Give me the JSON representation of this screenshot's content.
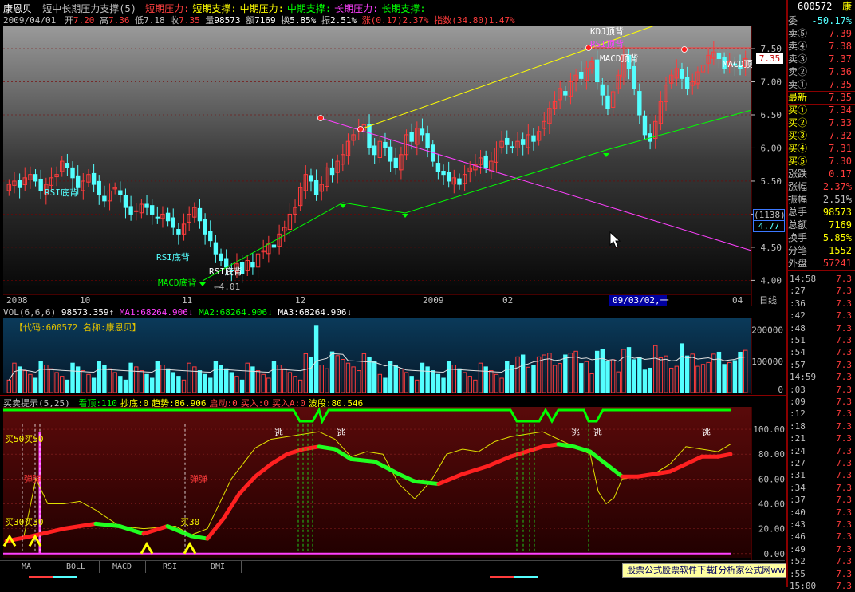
{
  "header": {
    "stock_name": "康恩贝",
    "indicator_title": "短中长期压力支撑(5)",
    "lines": [
      {
        "label": "短期压力:",
        "color": "#ff4040"
      },
      {
        "label": "短期支撑:",
        "color": "#ffff00"
      },
      {
        "label": "中期压力:",
        "color": "#ffff00"
      },
      {
        "label": "中期支撑:",
        "color": "#00ff00"
      },
      {
        "label": "长期压力:",
        "color": "#ff40ff"
      },
      {
        "label": "长期支撑:",
        "color": "#00ff00"
      }
    ],
    "date": "2009/04/01",
    "open_label": "开",
    "open": "7.20",
    "high_label": "高",
    "high": "7.36",
    "low_label": "低",
    "low": "7.18",
    "close_label": "收",
    "close": "7.35",
    "vol_label": "量",
    "vol": "98573",
    "amount_label": "额",
    "amount": "7169",
    "turnover_label": "换",
    "turnover": "5.85%",
    "amplitude_label": "振",
    "amplitude": "2.51%",
    "change_label": "涨",
    "change": "(0.17)",
    "change_pct": "2.37%",
    "index_label": "指数",
    "index": "(34.80)",
    "index_pct": "1.47%"
  },
  "main_chart": {
    "annotations": {
      "kdj_top": "KDJ顶背",
      "rsi_top": "RSI顶背",
      "macd_top": "MACD顶背",
      "macd_top2": "MACD顶",
      "rsi_bottom1": "RSI底背",
      "rsi_bottom2": "RSI底背",
      "rsi_bottom3": "RSI底背",
      "macd_bottom": "MACD底背",
      "low_mark": "4.01",
      "cursor_info": "(1138)",
      "cursor_price": "4.77",
      "current_price_tag": "7.35"
    },
    "price_ticks": [
      "7.50",
      "7.00",
      "6.50",
      "6.00",
      "5.50",
      "5.00",
      "4.50",
      "4.00"
    ],
    "date_labels": [
      "2008",
      "10",
      "11",
      "12",
      "2009",
      "02",
      "09/03/02,一",
      "04"
    ],
    "period_label": "日线"
  },
  "volume_panel": {
    "title": "VOL(6,6,6)",
    "vol_value": "98573.359",
    "ma1_label": "MA1:",
    "ma1": "68264.906",
    "ma2_label": "MA2:",
    "ma2": "68264.906",
    "ma3_label": "MA3:",
    "ma3": "68264.906",
    "info": "【代码:600572 名称:康恩贝】",
    "ticks": [
      "200000",
      "100000",
      "0"
    ]
  },
  "signal_panel": {
    "title": "买卖提示(5,25)",
    "items": [
      {
        "label": "看顶:",
        "value": "110",
        "color": "#00ff00"
      },
      {
        "label": "抄底:",
        "value": "0",
        "color": "#ffff00"
      },
      {
        "label": "趋势:",
        "value": "86.906",
        "color": "#ffff00"
      },
      {
        "label": "启动:",
        "value": "0",
        "color": "#ff4040"
      },
      {
        "label": "买入:",
        "value": "0",
        "color": "#ff4040"
      },
      {
        "label": "买入A:",
        "value": "0",
        "color": "#ff4040"
      },
      {
        "label": "波段:",
        "value": "80.546",
        "color": "#ffff00"
      }
    ],
    "annotations": {
      "buy50": "买50买50",
      "buy30a": "买30买30",
      "buy30b": "买30",
      "bounce1": "弹弹",
      "bounce2": "弹弹",
      "escape": "逃"
    },
    "ticks": [
      "100.00",
      "80.00",
      "60.00",
      "40.00",
      "20.00",
      "0.00"
    ]
  },
  "right_panel": {
    "code": "600572",
    "name_short": "康",
    "ratio_label": "委",
    "ratio": "-50.17%",
    "sells": [
      {
        "label": "卖⑤",
        "price": "7.39"
      },
      {
        "label": "卖④",
        "price": "7.38"
      },
      {
        "label": "卖③",
        "price": "7.37"
      },
      {
        "label": "卖②",
        "price": "7.36"
      },
      {
        "label": "卖①",
        "price": "7.35"
      }
    ],
    "latest_label": "最新",
    "latest": "7.35",
    "buys": [
      {
        "label": "买①",
        "price": "7.34"
      },
      {
        "label": "买②",
        "price": "7.33"
      },
      {
        "label": "买③",
        "price": "7.32"
      },
      {
        "label": "买④",
        "price": "7.31"
      },
      {
        "label": "买⑤",
        "price": "7.30"
      }
    ],
    "stats": [
      {
        "label": "涨跌",
        "value": "0.17",
        "color": "#ff3c3c"
      },
      {
        "label": "涨幅",
        "value": "2.37%",
        "color": "#ff3c3c"
      },
      {
        "label": "振幅",
        "value": "2.51%",
        "color": "#c0c0c0"
      },
      {
        "label": "总手",
        "value": "98573",
        "color": "#ffff00"
      },
      {
        "label": "总额",
        "value": "7169",
        "color": "#ffff00"
      },
      {
        "label": "换手",
        "value": "5.85%",
        "color": "#ffff00"
      },
      {
        "label": "分笔",
        "value": "1552",
        "color": "#ffff00"
      },
      {
        "label": "外盘",
        "value": "57241",
        "color": "#ff3c3c"
      }
    ],
    "ticks_list": [
      {
        "t": "14:58",
        "p": "7.3"
      },
      {
        "t": ":27",
        "p": "7.3"
      },
      {
        "t": ":36",
        "p": "7.3"
      },
      {
        "t": ":42",
        "p": "7.3"
      },
      {
        "t": ":48",
        "p": "7.3"
      },
      {
        "t": ":51",
        "p": "7.3"
      },
      {
        "t": ":54",
        "p": "7.3"
      },
      {
        "t": ":57",
        "p": "7.3"
      },
      {
        "t": "14:59",
        "p": "7.3"
      },
      {
        "t": ":03",
        "p": "7.3"
      },
      {
        "t": ":09",
        "p": "7.3"
      },
      {
        "t": ":12",
        "p": "7.3"
      },
      {
        "t": ":18",
        "p": "7.3"
      },
      {
        "t": ":21",
        "p": "7.3"
      },
      {
        "t": ":24",
        "p": "7.3"
      },
      {
        "t": ":27",
        "p": "7.3"
      },
      {
        "t": ":31",
        "p": "7.3"
      },
      {
        "t": ":34",
        "p": "7.3"
      },
      {
        "t": ":37",
        "p": "7.3"
      },
      {
        "t": ":40",
        "p": "7.3"
      },
      {
        "t": ":43",
        "p": "7.3"
      },
      {
        "t": ":46",
        "p": "7.3"
      },
      {
        "t": ":49",
        "p": "7.3"
      },
      {
        "t": ":52",
        "p": "7.3"
      },
      {
        "t": ":55",
        "p": "7.3"
      },
      {
        "t": "15:00",
        "p": "7.3"
      }
    ]
  },
  "tabs": [
    "MA",
    "BOLL",
    "MACD",
    "RSI",
    "DMI"
  ],
  "watermark": "股票公式股票软件下载[分析家公式网www.88gs.com]",
  "colors": {
    "up": "#ff3c3c",
    "down": "#54ffff",
    "grid": "#8a0000",
    "yellow": "#ffff00",
    "green": "#00ff00",
    "magenta": "#ff40ff"
  }
}
